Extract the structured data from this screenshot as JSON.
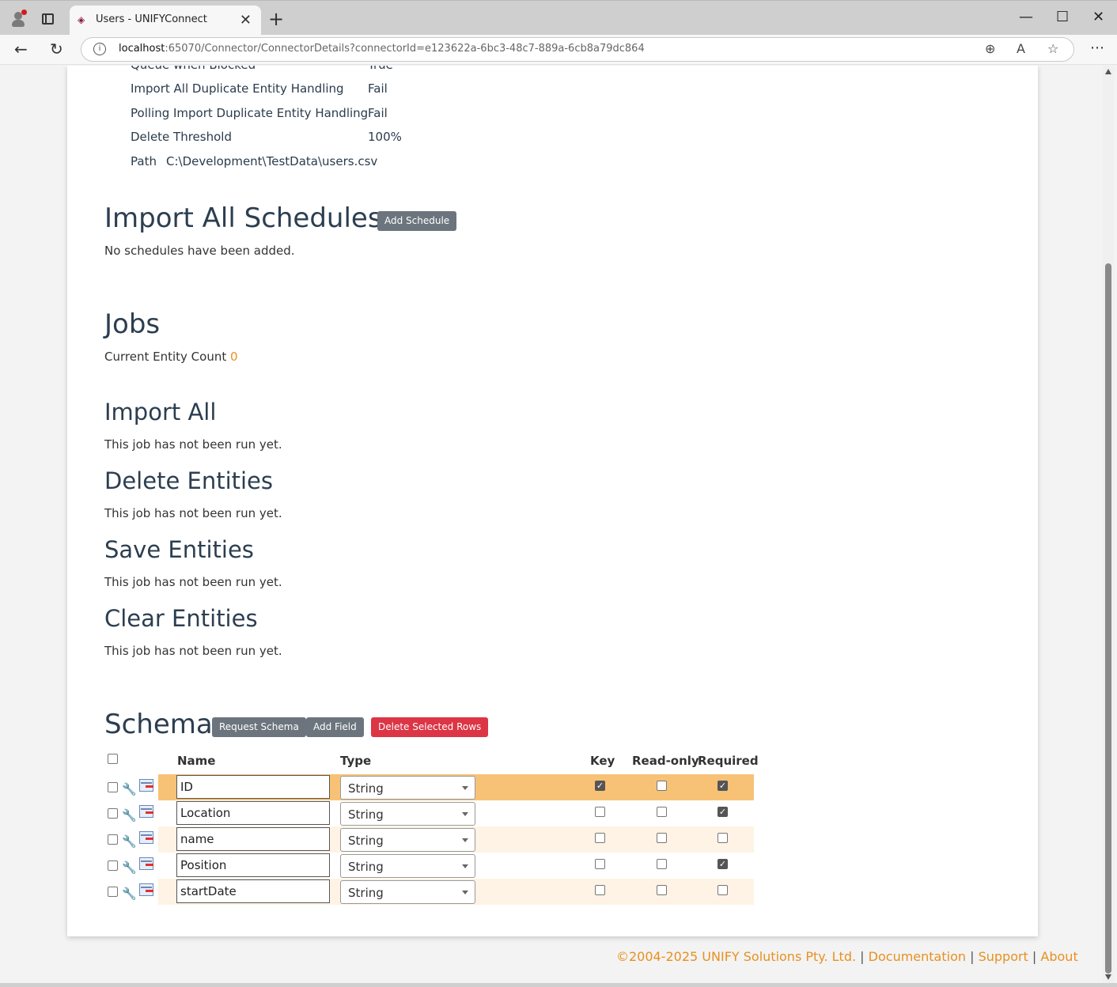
{
  "browser": {
    "tab_title": "Users - UNIFYConnect",
    "url_host": "localhost",
    "url_rest": ":65070/Connector/ConnectorDetails?connectorId=e123622a-6bc3-48c7-889a-6cb8a79dc864"
  },
  "properties": [
    {
      "label": "Queue when Blocked",
      "value": "True"
    },
    {
      "label": "Import All Duplicate Entity Handling",
      "value": "Fail"
    },
    {
      "label": "Polling Import Duplicate Entity Handling",
      "value": "Fail"
    },
    {
      "label": "Delete Threshold",
      "value": "100%"
    },
    {
      "label": "Path",
      "value": "C:\\Development\\TestData\\users.csv"
    }
  ],
  "schedules": {
    "title": "Import All Schedules",
    "add_button": "Add Schedule",
    "empty_text": "No schedules have been added."
  },
  "jobs": {
    "title": "Jobs",
    "entity_count_label": "Current Entity Count",
    "entity_count": "0",
    "sections": [
      {
        "title": "Import All",
        "status": "This job has not been run yet."
      },
      {
        "title": "Delete Entities",
        "status": "This job has not been run yet."
      },
      {
        "title": "Save Entities",
        "status": "This job has not been run yet."
      },
      {
        "title": "Clear Entities",
        "status": "This job has not been run yet."
      }
    ]
  },
  "schema": {
    "title": "Schema",
    "request_button": "Request Schema",
    "add_field_button": "Add Field",
    "delete_rows_button": "Delete Selected Rows",
    "columns": {
      "name": "Name",
      "type": "Type",
      "key": "Key",
      "readonly": "Read-only",
      "required": "Required"
    },
    "rows": [
      {
        "name": "ID",
        "type": "String",
        "key": true,
        "readonly": false,
        "required": true,
        "highlight": "selected"
      },
      {
        "name": "Location",
        "type": "String",
        "key": false,
        "readonly": false,
        "required": true,
        "highlight": "none"
      },
      {
        "name": "name",
        "type": "String",
        "key": false,
        "readonly": false,
        "required": false,
        "highlight": "alt"
      },
      {
        "name": "Position",
        "type": "String",
        "key": false,
        "readonly": false,
        "required": true,
        "highlight": "none"
      },
      {
        "name": "startDate",
        "type": "String",
        "key": false,
        "readonly": false,
        "required": false,
        "highlight": "alt"
      }
    ]
  },
  "footer": {
    "copyright": "©2004-2025 UNIFY Solutions Pty. Ltd.",
    "documentation": "Documentation",
    "support": "Support",
    "about": "About",
    "separator": "|"
  },
  "colors": {
    "accent": "#e8901f",
    "danger": "#dc3545",
    "secondary": "#6c757d",
    "row_selected": "#f7c276",
    "row_alt": "#fef3e4"
  }
}
